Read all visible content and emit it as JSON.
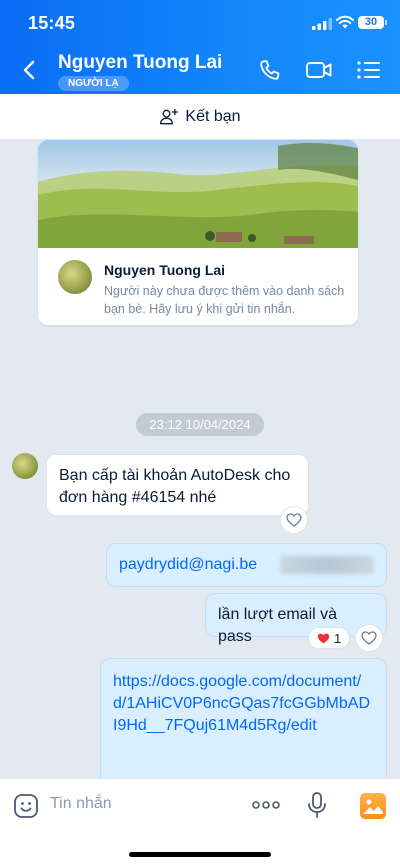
{
  "status_bar": {
    "time": "15:45",
    "battery": "30"
  },
  "header": {
    "title": "Nguyen Tuong Lai",
    "badge": "NGƯỜI LẠ",
    "colors": {
      "primary": "#1479F8"
    }
  },
  "add_friend": {
    "label": "Kết bạn"
  },
  "profile_card": {
    "name": "Nguyen Tuong Lai",
    "note": "Người này chưa được thêm vào danh sách bạn bè. Hãy lưu ý khi gửi tin nhắn."
  },
  "timestamp": "23:12 10/04/2024",
  "messages": [
    {
      "direction": "incoming",
      "text": "Bạn cấp tài khoản AutoDesk cho đơn hàng #46154 nhé"
    },
    {
      "direction": "outgoing",
      "text": "paydrydid@nagi.be"
    },
    {
      "direction": "outgoing",
      "text": "lần lượt email và pass",
      "reaction": {
        "emoji": "heart",
        "count": "1"
      }
    },
    {
      "direction": "outgoing",
      "text": "https://docs.google.com/document/d/1AHiCV0P6ncGQas7fcGGbMbADI9Hd__7FQuj61M4d5Rg/edit"
    }
  ],
  "input": {
    "placeholder": "Tin nhắn"
  },
  "icons": [
    "back-icon",
    "phone-icon",
    "video-call-icon",
    "menu-list-icon",
    "add-friend-icon",
    "heart-icon",
    "emoji-icon",
    "more-icon",
    "mic-icon",
    "image-icon"
  ]
}
